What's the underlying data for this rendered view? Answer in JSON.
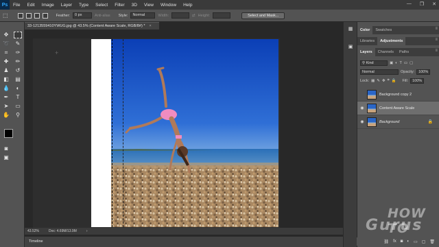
{
  "app": {
    "logo": "Ps"
  },
  "menu": [
    "File",
    "Edit",
    "Image",
    "Layer",
    "Type",
    "Select",
    "Filter",
    "3D",
    "View",
    "Window",
    "Help"
  ],
  "window_controls": {
    "minimize": "—",
    "restore": "❐",
    "close": "✕"
  },
  "options": {
    "feather_label": "Feather:",
    "feather_value": "0 px",
    "antialias_label": "Anti-alias",
    "style_label": "Style:",
    "style_value": "Normal",
    "width_label": "Width:",
    "height_label": "Height:",
    "select_mask_button": "Select and Mask..."
  },
  "document": {
    "tab_title": "33-1213559410YWUG.jpg @ 43.5% (Content Aware Scale, RGB/8#) *",
    "close": "×"
  },
  "status": {
    "zoom": "43.52%",
    "doc": "Doc: 4.69M/13.9M",
    "arrow": "›"
  },
  "timeline": {
    "label": "Timeline"
  },
  "panels": {
    "top_tabs": [
      "Color",
      "Swatches"
    ],
    "mid_tabs": [
      "Libraries",
      "Adjustments"
    ],
    "layer_tabs": [
      "Layers",
      "Channels",
      "Paths"
    ],
    "filter_kind": "Kind",
    "blend_mode": "Normal",
    "opacity_label": "Opacity:",
    "opacity_value": "100%",
    "lock_label": "Lock:",
    "fill_label": "Fill:",
    "fill_value": "100%"
  },
  "layers": [
    {
      "name": "Background copy 2",
      "visible": false,
      "selected": false,
      "locked": false
    },
    {
      "name": "Content Aware Scale",
      "visible": true,
      "selected": true,
      "locked": false
    },
    {
      "name": "Background",
      "visible": true,
      "selected": false,
      "locked": true
    }
  ],
  "watermark": {
    "line1": "HOW TO",
    "line2": "Gurus"
  }
}
